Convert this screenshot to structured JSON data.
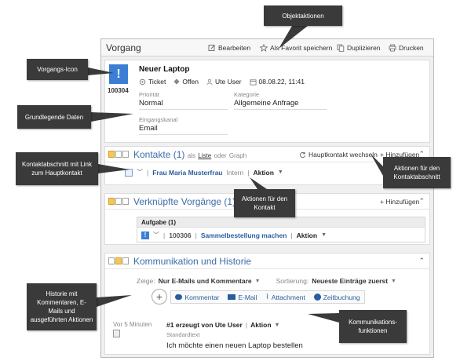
{
  "header": {
    "title": "Vorgang",
    "actions": [
      {
        "label": "Bearbeiten",
        "icon": "edit-icon"
      },
      {
        "label": "Als Favorit speichern",
        "icon": "star-icon"
      },
      {
        "label": "Duplizieren",
        "icon": "copy-icon"
      },
      {
        "label": "Drucken",
        "icon": "print-icon"
      }
    ]
  },
  "ticket": {
    "id": "100304",
    "title": "Neuer Laptop",
    "type": "Ticket",
    "status": "Offen",
    "user": "Ute User",
    "date": "08.08.22, 11:41",
    "fields": {
      "prioritaet_label": "Priorität",
      "prioritaet": "Normal",
      "kategorie_label": "Kategorie",
      "kategorie": "Allgemeine Anfrage",
      "eingangskanal_label": "Eingangskanal",
      "eingangskanal": "Email"
    }
  },
  "kontakte": {
    "title": "Kontakte (1)",
    "view_prefix": "als",
    "view_list": "Liste",
    "view_or": "oder",
    "view_graph": "Graph",
    "switch_label": "Hauptkontakt wechseln",
    "add_label": "+ Hinzufügen",
    "contact_name": "Frau Maria Musterfrau",
    "contact_type": "Intern",
    "aktion": "Aktion"
  },
  "verknuepfte": {
    "title": "Verknüpfte Vorgänge (1)",
    "add_label": "+ Hinzufügen",
    "group_label": "Aufgabe (1)",
    "task_id": "100306",
    "task_name": "Sammelbestellung machen",
    "aktion": "Aktion"
  },
  "kommunikation": {
    "title": "Kommunikation und Historie",
    "zeige_label": "Zeige:",
    "zeige_value": "Nur E-Mails und Kommentare",
    "sort_label": "Sortierung:",
    "sort_value": "Neueste Einträge zuerst",
    "buttons": [
      "Kommentar",
      "E-Mail",
      "Attachment",
      "Zeitbuchung"
    ],
    "entry_time": "Vor 5 Minuten",
    "entry_title": "#1 erzeugt von Ute User",
    "entry_aktion": "Aktion",
    "entry_sub": "Standardtext",
    "entry_text": "Ich möchte einen neuen Laptop bestellen"
  },
  "callouts": {
    "objektaktionen": "Objektaktionen",
    "vorgangs_icon": "Vorgangs-Icon",
    "grunddaten": "Grundlegende Daten",
    "kontaktabschnitt": "Kontaktabschnitt mit Link zum Hauptkontakt",
    "aktionen_kontakt": "Aktionen für den Kontakt",
    "aktionen_kontaktabschnitt": "Aktionen für den Kontaktabschnitt",
    "historie": "Historie mit Kommentaren, E-Mails und ausgeführten Aktionen",
    "kommunikationsfunktionen": "Kommunikations-funktionen"
  },
  "colors": {
    "accent": "#2a5d9f",
    "ticket_icon": "#3b7fd4",
    "callout_bg": "#3a3a3a"
  }
}
